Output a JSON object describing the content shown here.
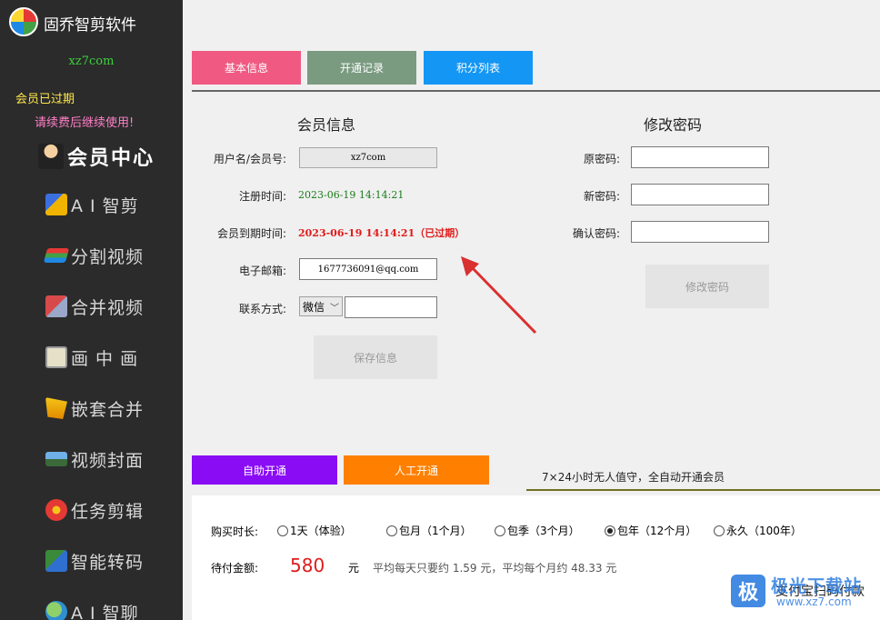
{
  "sidebar": {
    "app_title": "固乔智剪软件",
    "site_tag": "xz7com",
    "member_status": "会员已过期",
    "renew_hint": "请续费后继续使用!",
    "items": [
      {
        "label": "会员中心",
        "icon": "member-center-icon"
      },
      {
        "label": "A I 智剪",
        "icon": "ai-edit-icon"
      },
      {
        "label": "分割视频",
        "icon": "split-video-icon"
      },
      {
        "label": "合并视频",
        "icon": "merge-video-icon"
      },
      {
        "label": "画 中 画",
        "icon": "picture-in-picture-icon"
      },
      {
        "label": "嵌套合并",
        "icon": "nested-merge-icon"
      },
      {
        "label": "视频封面",
        "icon": "video-cover-icon"
      },
      {
        "label": "任务剪辑",
        "icon": "task-edit-icon"
      },
      {
        "label": "智能转码",
        "icon": "smart-transcode-icon"
      },
      {
        "label": "A I 智聊",
        "icon": "ai-chat-icon"
      }
    ]
  },
  "tabs": [
    {
      "label": "基本信息",
      "color": "#f05a82"
    },
    {
      "label": "开通记录",
      "color": "#7a9b80"
    },
    {
      "label": "积分列表",
      "color": "#1496f5"
    }
  ],
  "member_info": {
    "title": "会员信息",
    "username_label": "用户名/会员号:",
    "username_value": "xz7com",
    "register_label": "注册时间:",
    "register_value": "2023-06-19 14:14:21",
    "expire_label": "会员到期时间:",
    "expire_value": "2023-06-19 14:14:21（已过期）",
    "email_label": "电子邮箱:",
    "email_value": "1677736091@qq.com",
    "contact_label": "联系方式:",
    "contact_option": "微信",
    "contact_value": "",
    "save_button": "保存信息"
  },
  "password": {
    "title": "修改密码",
    "old_label": "原密码:",
    "new_label": "新密码:",
    "confirm_label": "确认密码:",
    "change_button": "修改密码"
  },
  "payment": {
    "auto_tab": "自助开通",
    "manual_tab": "人工开通",
    "auto_tab_color": "#8a0cf5",
    "manual_tab_color": "#ff7f00",
    "auto_note": "7×24小时无人值守，全自动开通会员",
    "duration_label": "购买时长:",
    "options": [
      {
        "label": "1天（体验）",
        "checked": false
      },
      {
        "label": "包月（1个月）",
        "checked": false
      },
      {
        "label": "包季（3个月）",
        "checked": false
      },
      {
        "label": "包年（12个月）",
        "checked": true
      },
      {
        "label": "永久（100年）",
        "checked": false
      }
    ],
    "amount_label": "待付金额:",
    "amount_value": "580",
    "amount_unit": "元",
    "amount_average": "平均每天只要约 1.59 元，平均每个月约 48.33 元",
    "alipay_text": "支付宝扫码付款"
  },
  "watermark": {
    "logo_text": "极",
    "name": "极光下载站",
    "url": "www.xz7.com"
  },
  "colors": {
    "sidebar_bg": "#2b2b2b",
    "expire_red": "#e01b1b",
    "register_green": "#1a7a1a",
    "arrow": "#d93030"
  }
}
